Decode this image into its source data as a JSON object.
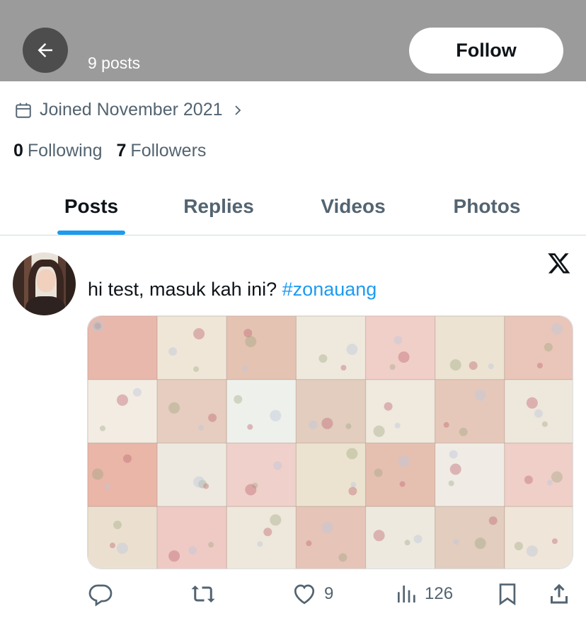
{
  "header": {
    "post_count": "9 posts",
    "follow_label": "Follow"
  },
  "profile": {
    "joined": "Joined November 2021",
    "following_count": "0",
    "following_label": "Following",
    "followers_count": "7",
    "followers_label": "Followers"
  },
  "tabs": [
    {
      "label": "Posts",
      "active": true
    },
    {
      "label": "Replies",
      "active": false
    },
    {
      "label": "Videos",
      "active": false
    },
    {
      "label": "Photos",
      "active": false
    }
  ],
  "tweet": {
    "text": "hi test, masuk kah ini?",
    "hashtag": "#zonauang",
    "likes": "9",
    "views": "126",
    "media_description_icon": "patchwork-fabric-image"
  },
  "colors": {
    "accent": "#1d9bf0",
    "header_bg": "#9b9b9b",
    "muted_text": "#536471"
  }
}
